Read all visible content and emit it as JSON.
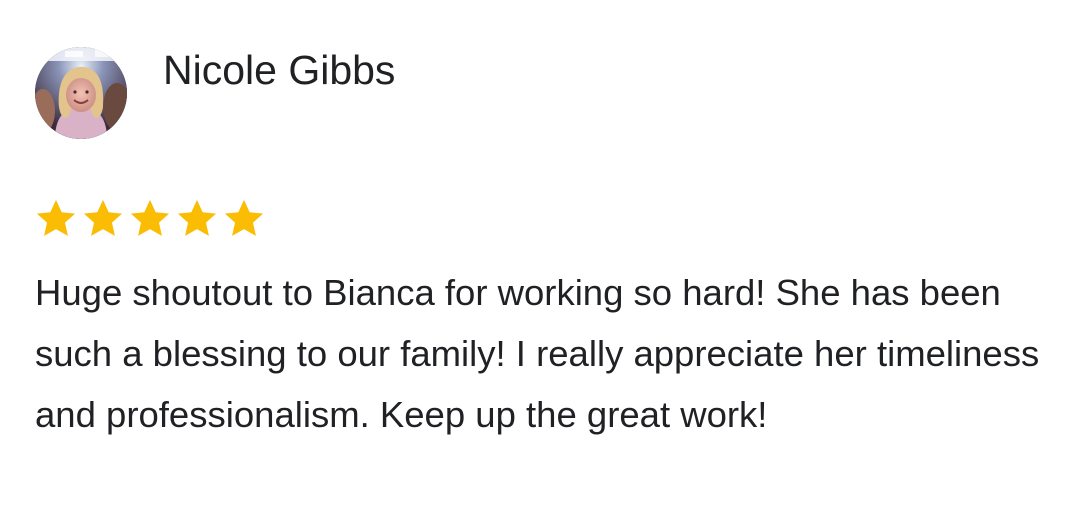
{
  "review": {
    "reviewer_name": "Nicole Gibbs",
    "avatar_icon": "user-photo-avatar",
    "rating": 5,
    "rating_max": 5,
    "star_color": "#fbbc04",
    "text": "Huge shoutout to Bianca for working so hard! She has been such a blessing to our family! I really appreciate her timeliness and professionalism. Keep up the great work!"
  }
}
